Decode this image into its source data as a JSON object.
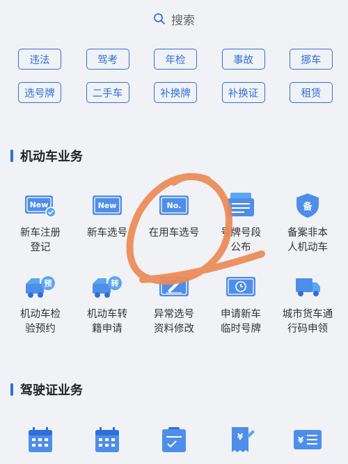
{
  "search": {
    "label": "搜索"
  },
  "quick_tags": [
    [
      "违法",
      "驾考",
      "年检",
      "事故",
      "挪车"
    ],
    [
      "选号牌",
      "二手车",
      "补换牌",
      "补换证",
      "租赁"
    ]
  ],
  "sections": {
    "vehicle": {
      "title": "机动车业务",
      "items": [
        {
          "icon": "new-plate-registration-icon",
          "line1": "新车注册",
          "line2": "登记",
          "badge": "New"
        },
        {
          "icon": "new-plate-icon",
          "line1": "新车选号",
          "line2": "",
          "badge": "New"
        },
        {
          "icon": "plate-number-icon",
          "line1": "在用车选号",
          "line2": "",
          "badge": "No."
        },
        {
          "icon": "plate-notice-icon",
          "line1": "号牌号段",
          "line2": "公布",
          "badge": ""
        },
        {
          "icon": "record-shield-icon",
          "line1": "备案非本",
          "line2": "人机动车",
          "badge": "备"
        },
        {
          "icon": "inspection-truck-icon",
          "line1": "机动车检",
          "line2": "验预约",
          "badge": "预"
        },
        {
          "icon": "transfer-truck-icon",
          "line1": "机动车转",
          "line2": "籍申请",
          "badge": "转"
        },
        {
          "icon": "plate-edit-icon",
          "line1": "异常选号",
          "line2": "资料修改",
          "badge": ""
        },
        {
          "icon": "temporary-plate-icon",
          "line1": "申请新车",
          "line2": "临时号牌",
          "badge": ""
        },
        {
          "icon": "freight-truck-icon",
          "line1": "城市货车通",
          "line2": "行码申领",
          "badge": ""
        }
      ]
    },
    "license": {
      "title": "驾驶证业务",
      "items": [
        {
          "icon": "calendar-icon"
        },
        {
          "icon": "calendar-icon"
        },
        {
          "icon": "checklist-icon"
        },
        {
          "icon": "receipt-pen-icon"
        },
        {
          "icon": "payment-card-icon"
        }
      ]
    }
  },
  "colors": {
    "accent": "#2f6fd9",
    "icon_light": "#5ba6f2",
    "annotation": "#ec8a55",
    "background": "#f1f2f6"
  }
}
